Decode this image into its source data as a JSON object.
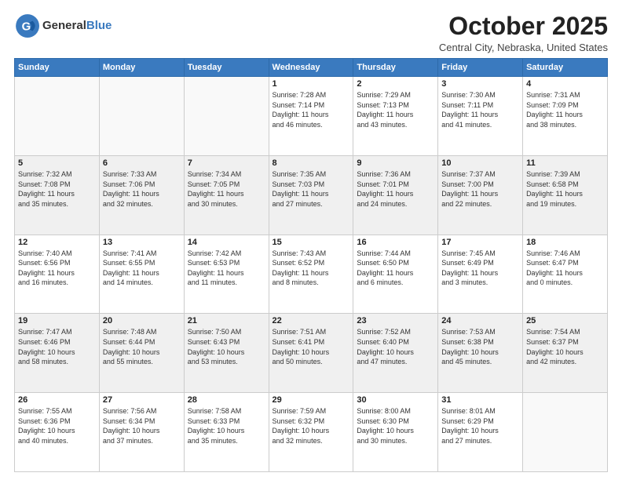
{
  "logo": {
    "general": "General",
    "blue": "Blue"
  },
  "title": {
    "month": "October 2025",
    "location": "Central City, Nebraska, United States"
  },
  "weekdays": [
    "Sunday",
    "Monday",
    "Tuesday",
    "Wednesday",
    "Thursday",
    "Friday",
    "Saturday"
  ],
  "weeks": [
    {
      "days": [
        {
          "num": "",
          "info": ""
        },
        {
          "num": "",
          "info": ""
        },
        {
          "num": "",
          "info": ""
        },
        {
          "num": "1",
          "info": "Sunrise: 7:28 AM\nSunset: 7:14 PM\nDaylight: 11 hours\nand 46 minutes."
        },
        {
          "num": "2",
          "info": "Sunrise: 7:29 AM\nSunset: 7:13 PM\nDaylight: 11 hours\nand 43 minutes."
        },
        {
          "num": "3",
          "info": "Sunrise: 7:30 AM\nSunset: 7:11 PM\nDaylight: 11 hours\nand 41 minutes."
        },
        {
          "num": "4",
          "info": "Sunrise: 7:31 AM\nSunset: 7:09 PM\nDaylight: 11 hours\nand 38 minutes."
        }
      ]
    },
    {
      "days": [
        {
          "num": "5",
          "info": "Sunrise: 7:32 AM\nSunset: 7:08 PM\nDaylight: 11 hours\nand 35 minutes."
        },
        {
          "num": "6",
          "info": "Sunrise: 7:33 AM\nSunset: 7:06 PM\nDaylight: 11 hours\nand 32 minutes."
        },
        {
          "num": "7",
          "info": "Sunrise: 7:34 AM\nSunset: 7:05 PM\nDaylight: 11 hours\nand 30 minutes."
        },
        {
          "num": "8",
          "info": "Sunrise: 7:35 AM\nSunset: 7:03 PM\nDaylight: 11 hours\nand 27 minutes."
        },
        {
          "num": "9",
          "info": "Sunrise: 7:36 AM\nSunset: 7:01 PM\nDaylight: 11 hours\nand 24 minutes."
        },
        {
          "num": "10",
          "info": "Sunrise: 7:37 AM\nSunset: 7:00 PM\nDaylight: 11 hours\nand 22 minutes."
        },
        {
          "num": "11",
          "info": "Sunrise: 7:39 AM\nSunset: 6:58 PM\nDaylight: 11 hours\nand 19 minutes."
        }
      ]
    },
    {
      "days": [
        {
          "num": "12",
          "info": "Sunrise: 7:40 AM\nSunset: 6:56 PM\nDaylight: 11 hours\nand 16 minutes."
        },
        {
          "num": "13",
          "info": "Sunrise: 7:41 AM\nSunset: 6:55 PM\nDaylight: 11 hours\nand 14 minutes."
        },
        {
          "num": "14",
          "info": "Sunrise: 7:42 AM\nSunset: 6:53 PM\nDaylight: 11 hours\nand 11 minutes."
        },
        {
          "num": "15",
          "info": "Sunrise: 7:43 AM\nSunset: 6:52 PM\nDaylight: 11 hours\nand 8 minutes."
        },
        {
          "num": "16",
          "info": "Sunrise: 7:44 AM\nSunset: 6:50 PM\nDaylight: 11 hours\nand 6 minutes."
        },
        {
          "num": "17",
          "info": "Sunrise: 7:45 AM\nSunset: 6:49 PM\nDaylight: 11 hours\nand 3 minutes."
        },
        {
          "num": "18",
          "info": "Sunrise: 7:46 AM\nSunset: 6:47 PM\nDaylight: 11 hours\nand 0 minutes."
        }
      ]
    },
    {
      "days": [
        {
          "num": "19",
          "info": "Sunrise: 7:47 AM\nSunset: 6:46 PM\nDaylight: 10 hours\nand 58 minutes."
        },
        {
          "num": "20",
          "info": "Sunrise: 7:48 AM\nSunset: 6:44 PM\nDaylight: 10 hours\nand 55 minutes."
        },
        {
          "num": "21",
          "info": "Sunrise: 7:50 AM\nSunset: 6:43 PM\nDaylight: 10 hours\nand 53 minutes."
        },
        {
          "num": "22",
          "info": "Sunrise: 7:51 AM\nSunset: 6:41 PM\nDaylight: 10 hours\nand 50 minutes."
        },
        {
          "num": "23",
          "info": "Sunrise: 7:52 AM\nSunset: 6:40 PM\nDaylight: 10 hours\nand 47 minutes."
        },
        {
          "num": "24",
          "info": "Sunrise: 7:53 AM\nSunset: 6:38 PM\nDaylight: 10 hours\nand 45 minutes."
        },
        {
          "num": "25",
          "info": "Sunrise: 7:54 AM\nSunset: 6:37 PM\nDaylight: 10 hours\nand 42 minutes."
        }
      ]
    },
    {
      "days": [
        {
          "num": "26",
          "info": "Sunrise: 7:55 AM\nSunset: 6:36 PM\nDaylight: 10 hours\nand 40 minutes."
        },
        {
          "num": "27",
          "info": "Sunrise: 7:56 AM\nSunset: 6:34 PM\nDaylight: 10 hours\nand 37 minutes."
        },
        {
          "num": "28",
          "info": "Sunrise: 7:58 AM\nSunset: 6:33 PM\nDaylight: 10 hours\nand 35 minutes."
        },
        {
          "num": "29",
          "info": "Sunrise: 7:59 AM\nSunset: 6:32 PM\nDaylight: 10 hours\nand 32 minutes."
        },
        {
          "num": "30",
          "info": "Sunrise: 8:00 AM\nSunset: 6:30 PM\nDaylight: 10 hours\nand 30 minutes."
        },
        {
          "num": "31",
          "info": "Sunrise: 8:01 AM\nSunset: 6:29 PM\nDaylight: 10 hours\nand 27 minutes."
        },
        {
          "num": "",
          "info": ""
        }
      ]
    }
  ]
}
